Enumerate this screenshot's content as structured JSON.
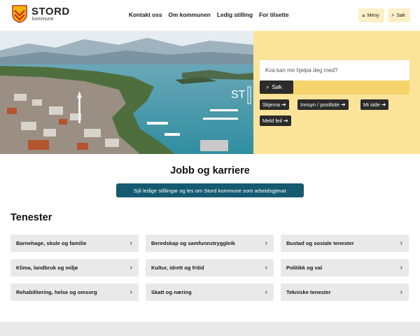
{
  "header": {
    "logo_name": "STORD",
    "logo_sub": "kommune",
    "nav": [
      "Kontakt oss",
      "Om kommunen",
      "Ledig stilling",
      "For tilsette"
    ],
    "menu_label": "Meny",
    "search_label": "Søk"
  },
  "hero": {
    "search_placeholder": "Kva kan me hjelpa deg med?",
    "search_button": "Søk",
    "quick_links": [
      "Skjema",
      "Innsyn / postliste",
      "Mi side",
      "Meld feil"
    ],
    "sign_text": "ST"
  },
  "jobb": {
    "title": "Jobb og karriere",
    "button": "Sjå ledige stillingar og les om Stord kommune som arbeidsgjevar"
  },
  "tenester": {
    "title": "Tenester",
    "items": [
      "Barnehage, skule og familie",
      "Beredskap og samfunnstryggleik",
      "Bustad og sosiale tenester",
      "Klima, landbruk og miljø",
      "Kultur, idrett og fritid",
      "Politikk og val",
      "Rehabilitering, helse og omsorg",
      "Skatt og næring",
      "Tekniske tenester"
    ]
  },
  "colors": {
    "accent_yellow": "#fbe49a",
    "button_teal": "#155a70",
    "dark_button": "#2b2b2b",
    "card_gray": "#e9e9e9"
  }
}
